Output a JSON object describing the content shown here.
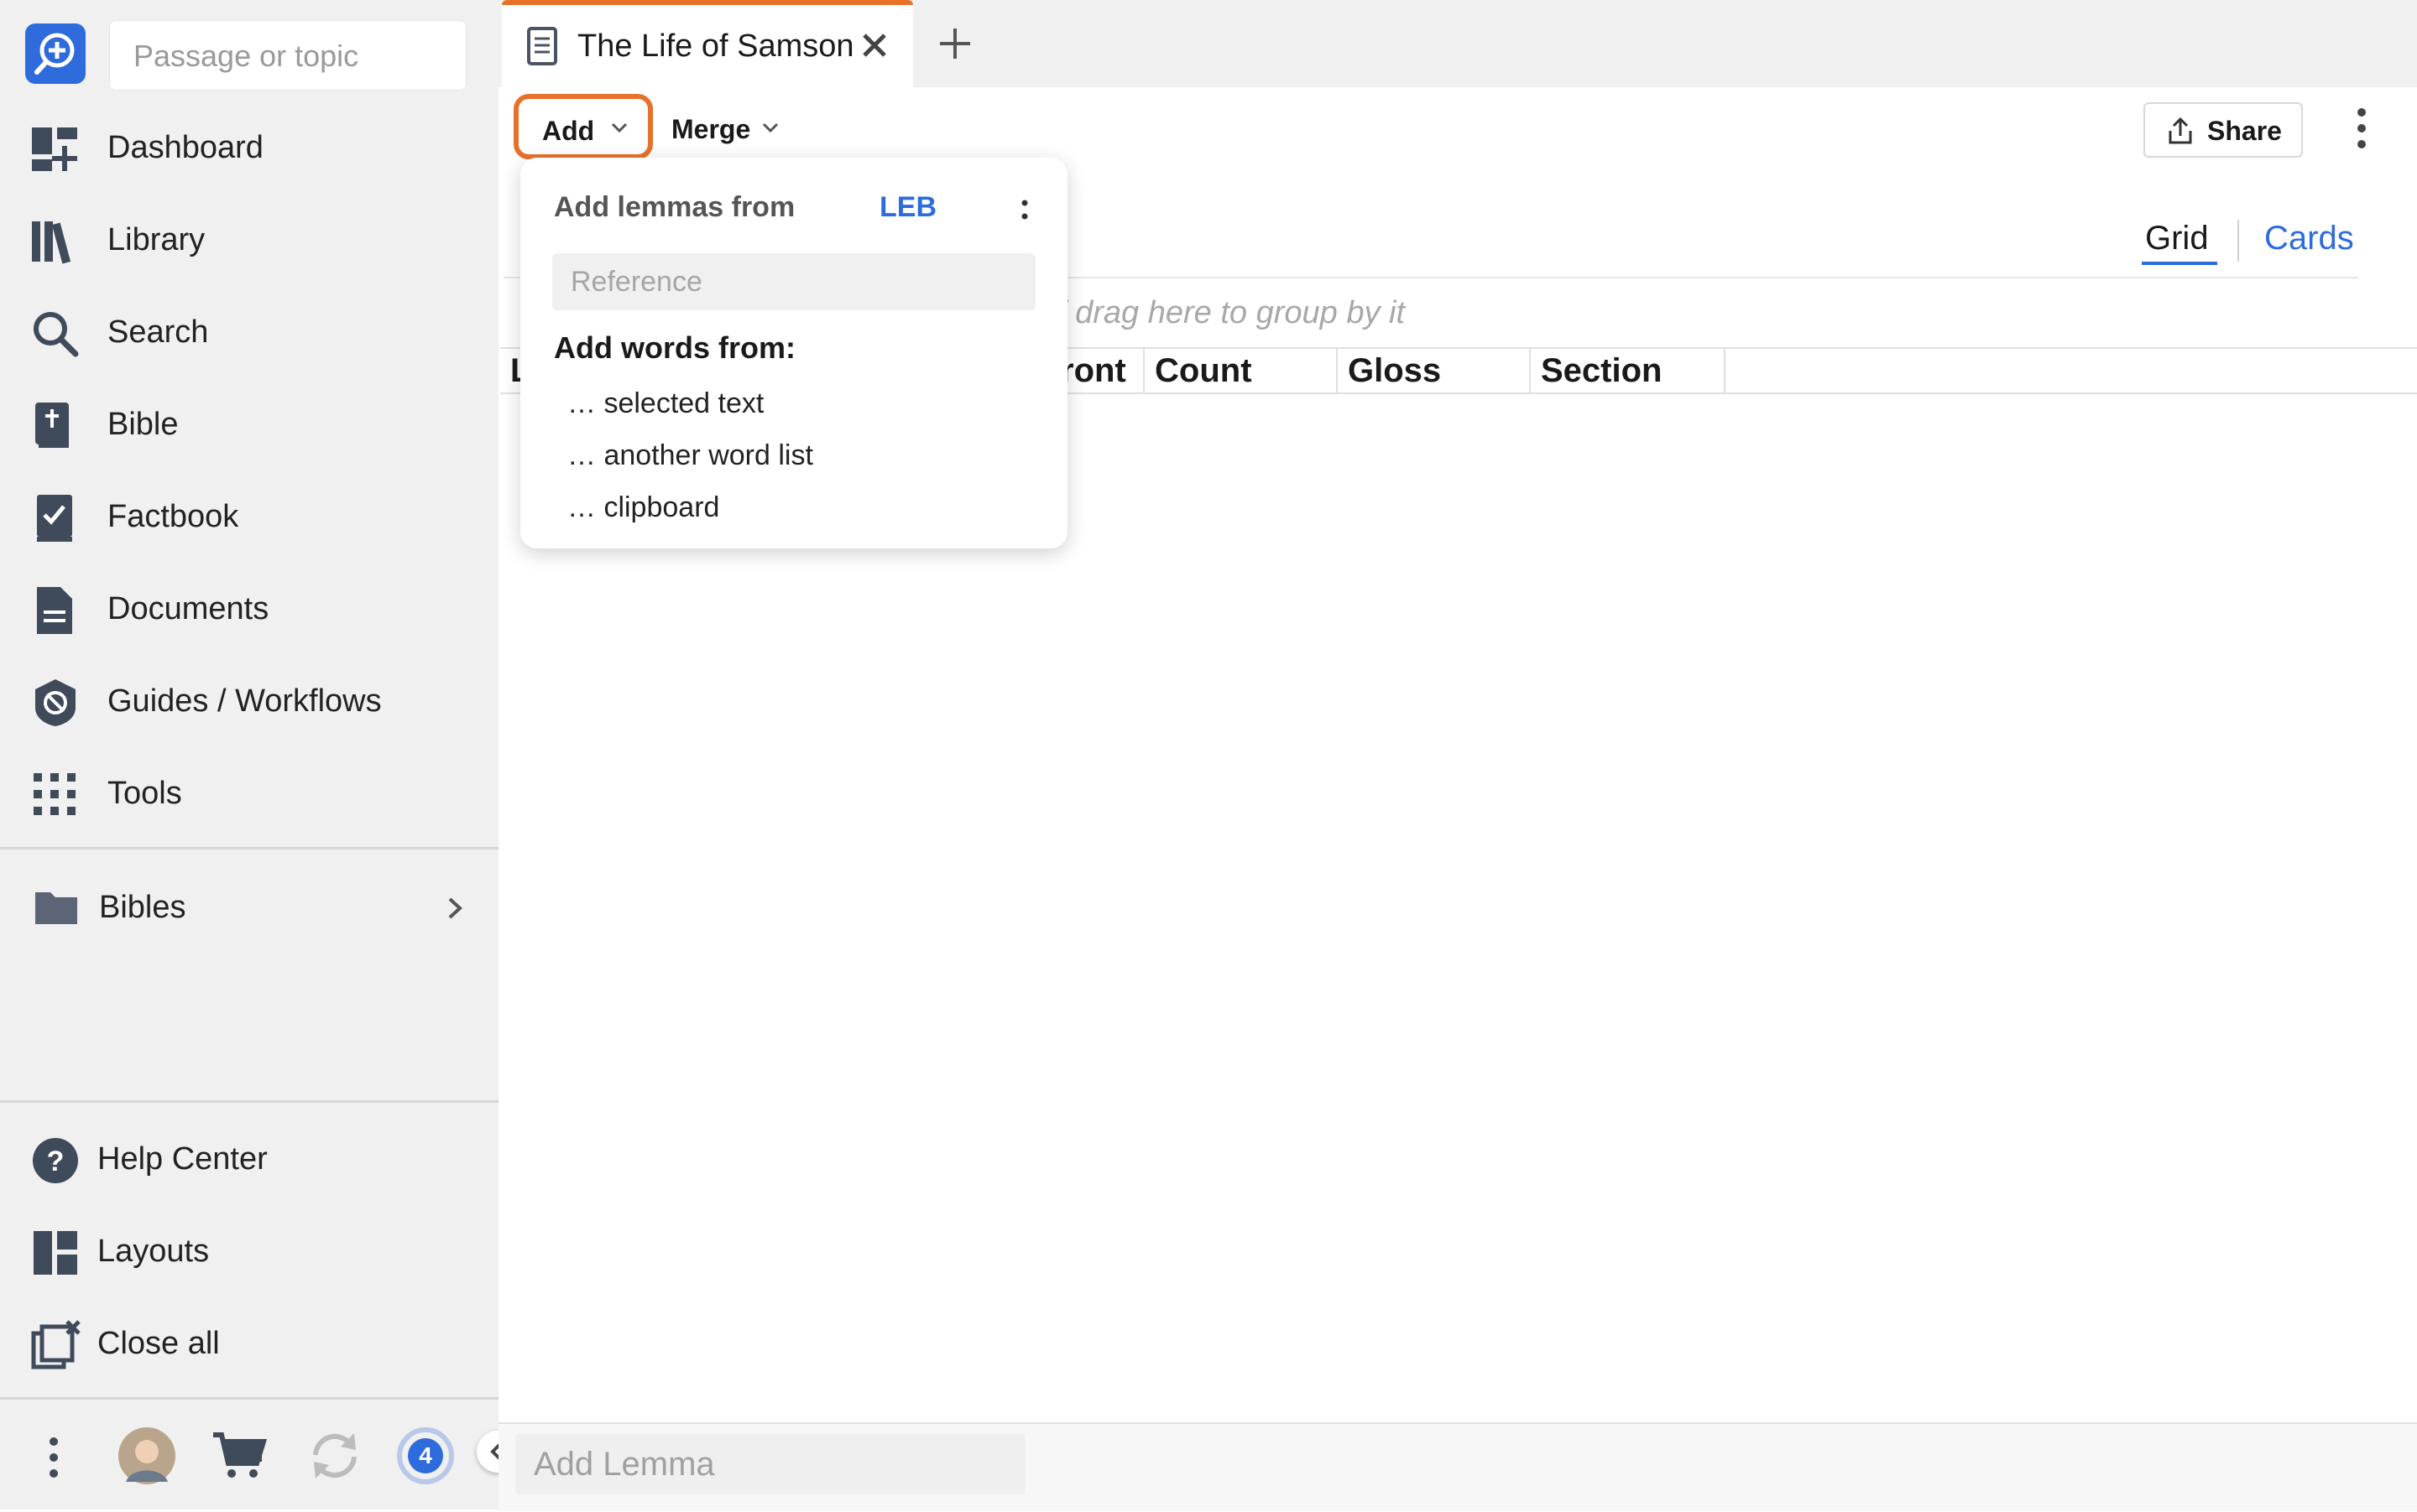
{
  "sidebar": {
    "search_placeholder": "Passage or topic",
    "items": [
      {
        "label": "Dashboard",
        "icon": "dashboard-icon"
      },
      {
        "label": "Library",
        "icon": "library-icon"
      },
      {
        "label": "Search",
        "icon": "search-icon"
      },
      {
        "label": "Bible",
        "icon": "bible-icon"
      },
      {
        "label": "Factbook",
        "icon": "factbook-icon"
      },
      {
        "label": "Documents",
        "icon": "documents-icon"
      },
      {
        "label": "Guides / Workflows",
        "icon": "guides-icon"
      },
      {
        "label": "Tools",
        "icon": "tools-grid-icon"
      }
    ],
    "folder": {
      "label": "Bibles",
      "icon": "folder-icon"
    },
    "bottom_items": [
      {
        "label": "Help Center",
        "icon": "help-icon"
      },
      {
        "label": "Layouts",
        "icon": "layouts-icon"
      },
      {
        "label": "Close all",
        "icon": "close-all-icon"
      }
    ],
    "notification_count": "4"
  },
  "tabs": [
    {
      "label": "The Life of Samson",
      "active": true
    }
  ],
  "toolbar": {
    "add_label": "Add",
    "merge_label": "Merge",
    "share_label": "Share"
  },
  "view_toggle": {
    "grid_label": "Grid",
    "cards_label": "Cards",
    "active": "Grid"
  },
  "group_hint": "drag here to group by it",
  "table": {
    "columns": [
      "L",
      "ront",
      "Count",
      "Gloss",
      "Section"
    ]
  },
  "add_menu": {
    "lemmas_label": "Add lemmas from",
    "version": "LEB",
    "reference_placeholder": "Reference",
    "words_heading": "Add words from:",
    "options": [
      "… selected text",
      "… another word list",
      "… clipboard"
    ]
  },
  "footer": {
    "add_lemma_placeholder": "Add Lemma"
  },
  "colors": {
    "accent": "#e8712a",
    "link": "#2e6bdc",
    "sidebar_bg": "#f0f0f0",
    "icon": "#3f4a5a"
  }
}
